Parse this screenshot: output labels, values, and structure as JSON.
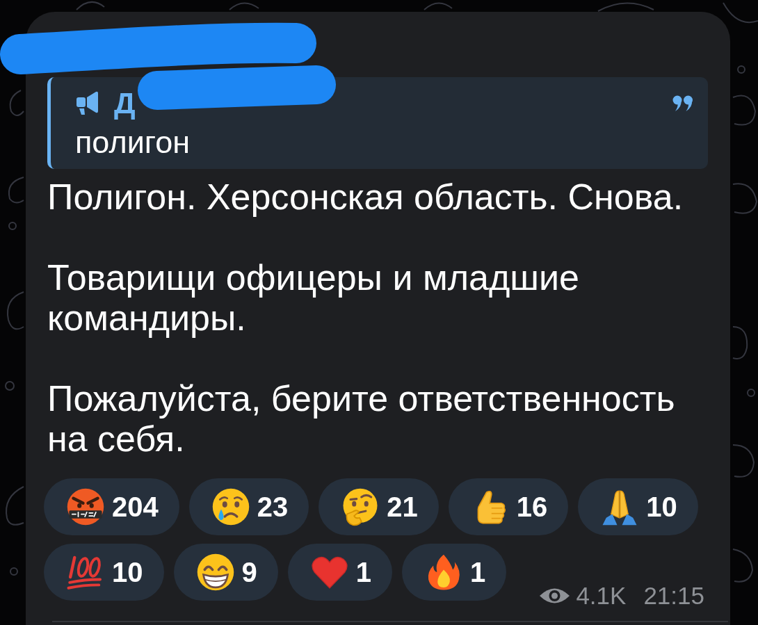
{
  "redaction_marks": true,
  "quote": {
    "author": "Д",
    "text": "полигон"
  },
  "message": {
    "paragraphs": [
      "Полигон. Херсонская область. Снова.",
      "Товарищи офицеры и младшие командиры.",
      "Пожалуйста, берите ответственность на себя."
    ]
  },
  "reactions": [
    {
      "kind": "cursing",
      "count": "204",
      "selected": false
    },
    {
      "kind": "crying",
      "count": "23",
      "selected": false
    },
    {
      "kind": "thinking",
      "count": "21",
      "selected": false
    },
    {
      "kind": "thumbsup",
      "count": "16",
      "selected": false
    },
    {
      "kind": "pray",
      "count": "10",
      "selected": false
    },
    {
      "kind": "hundred",
      "count": "10",
      "selected": false
    },
    {
      "kind": "grin",
      "count": "9",
      "selected": false
    },
    {
      "kind": "heart",
      "count": "1",
      "selected": false
    },
    {
      "kind": "fire",
      "count": "1",
      "selected": false
    }
  ],
  "footer": {
    "views": "4.1K",
    "time": "21:15"
  }
}
